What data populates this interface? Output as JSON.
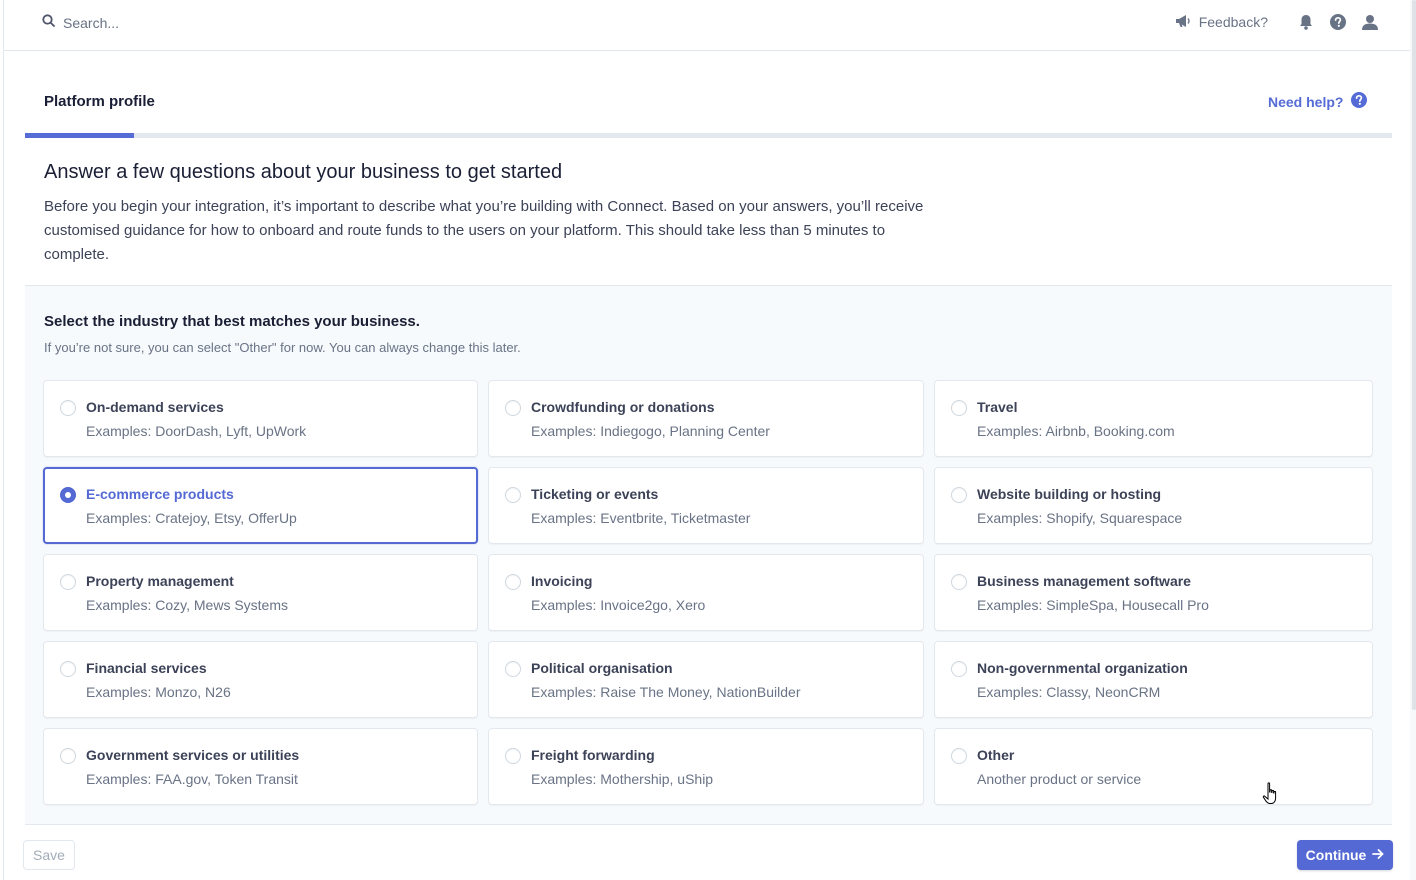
{
  "topbar": {
    "search_placeholder": "Search...",
    "feedback_label": "Feedback?"
  },
  "header": {
    "title": "Platform profile",
    "help_label": "Need help?",
    "progress_fraction": 0.08
  },
  "intro": {
    "title": "Answer a few questions about your business to get started",
    "body": "Before you begin your integration, it’s important to describe what you’re building with Connect. Based on your answers, you’ll receive customised guidance for how to onboard and route funds to the users on your platform. This should take less than 5 minutes to complete."
  },
  "question": {
    "title": "Select the industry that best matches your business.",
    "subtitle": "If you’re not sure, you can select \"Other\" for now. You can always change this later.",
    "options": [
      {
        "title": "On-demand services",
        "examples": "Examples: DoorDash, Lyft, UpWork"
      },
      {
        "title": "Crowdfunding or donations",
        "examples": "Examples: Indiegogo, Planning Center"
      },
      {
        "title": "Travel",
        "examples": "Examples: Airbnb, Booking.com"
      },
      {
        "title": "E-commerce products",
        "examples": "Examples: Cratejoy, Etsy, OfferUp",
        "selected": true
      },
      {
        "title": "Ticketing or events",
        "examples": "Examples: Eventbrite, Ticketmaster"
      },
      {
        "title": "Website building or hosting",
        "examples": "Examples: Shopify, Squarespace"
      },
      {
        "title": "Property management",
        "examples": "Examples: Cozy, Mews Systems"
      },
      {
        "title": "Invoicing",
        "examples": "Examples: Invoice2go, Xero"
      },
      {
        "title": "Business management software",
        "examples": "Examples: SimpleSpa, Housecall Pro"
      },
      {
        "title": "Financial services",
        "examples": "Examples: Monzo, N26"
      },
      {
        "title": "Political organisation",
        "examples": "Examples: Raise The Money, NationBuilder"
      },
      {
        "title": "Non-governmental organization",
        "examples": "Examples: Classy, NeonCRM"
      },
      {
        "title": "Government services or utilities",
        "examples": "Examples: FAA.gov, Token Transit"
      },
      {
        "title": "Freight forwarding",
        "examples": "Examples: Mothership, uShip"
      },
      {
        "title": "Other",
        "examples": "Another product or service"
      }
    ]
  },
  "footer": {
    "save_label": "Save",
    "continue_label": "Continue"
  },
  "colors": {
    "accent": "#5469d4",
    "link": "#556cd6",
    "muted_text": "#697386",
    "panel_bg": "#f7fafc"
  }
}
